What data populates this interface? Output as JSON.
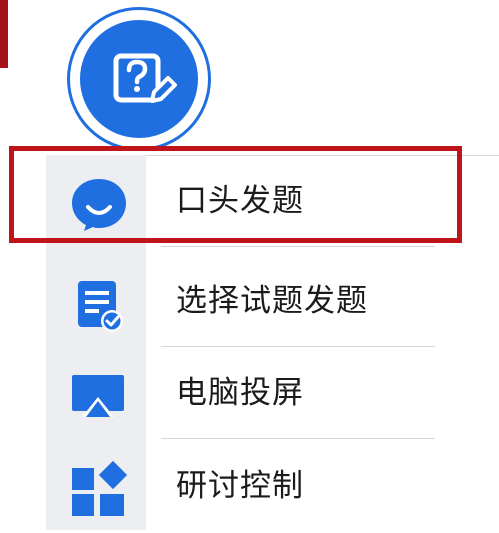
{
  "launcher": {
    "icon": "question-edit-icon",
    "accent": "#1f6fe0"
  },
  "menu": {
    "accent": "#1f6fe0",
    "highlight_color": "#c0141b",
    "items": [
      {
        "label": "口头发题",
        "icon": "speech-bubble-icon"
      },
      {
        "label": "选择试题发题",
        "icon": "document-check-icon"
      },
      {
        "label": "电脑投屏",
        "icon": "screen-cast-icon"
      },
      {
        "label": "研讨控制",
        "icon": "grid-control-icon"
      }
    ]
  }
}
